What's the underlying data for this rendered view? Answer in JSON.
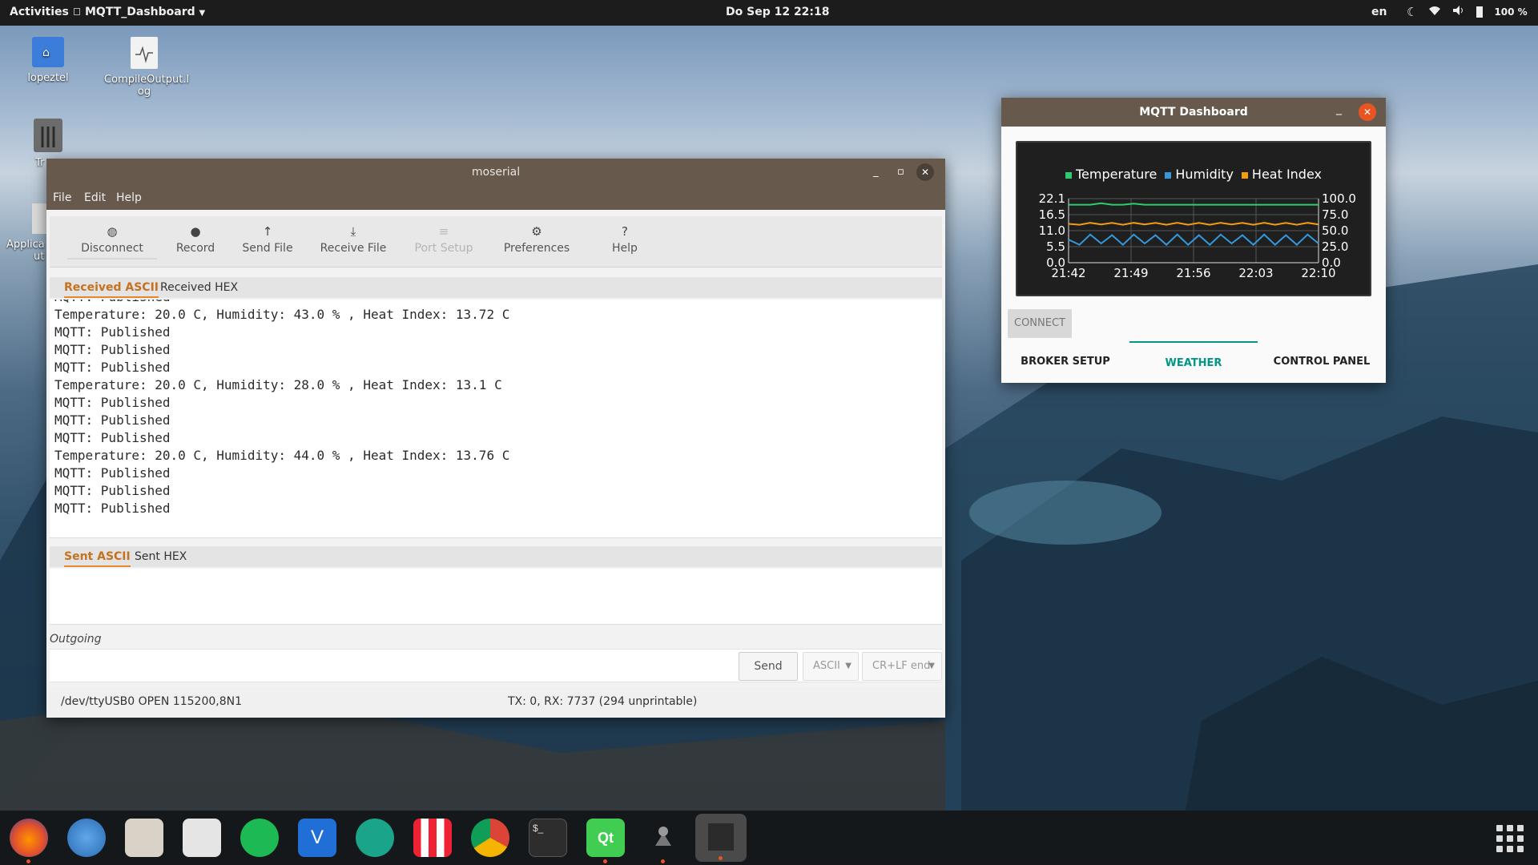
{
  "topbar": {
    "activities": "Activities",
    "app_menu": "MQTT_Dashboard",
    "clock": "Do Sep 12  22:18",
    "lang": "en",
    "battery": "100 %",
    "icons": [
      "night-light-icon",
      "wifi-icon",
      "volume-icon",
      "battery-icon"
    ]
  },
  "desktop": {
    "icons": [
      {
        "label": "lopeztel",
        "icon": "home-folder-icon"
      },
      {
        "label": "CompileOutput.log",
        "icon": "log-file-icon"
      },
      {
        "label": "Trash",
        "icon": "trash-icon"
      },
      {
        "label": "Applications",
        "icon": "app-icon"
      }
    ],
    "label_home": "lopeztel",
    "label_log_1": "CompileOutput.l",
    "label_log_2": "og",
    "label_trash": "Tr",
    "label_apps_1": "Applica",
    "label_apps_2": "ut"
  },
  "moserial": {
    "title": "moserial",
    "menu": {
      "file": "File",
      "edit": "Edit",
      "help": "Help"
    },
    "toolbar": {
      "disconnect": "Disconnect",
      "record": "Record",
      "send_file": "Send File",
      "receive_file": "Receive File",
      "port_setup": "Port Setup",
      "preferences": "Preferences",
      "help": "Help"
    },
    "recv_tabs": {
      "ascii": "Received ASCII",
      "hex": "Received HEX"
    },
    "received_lines": [
      "MQTT: Published",
      "Temperature: 20.0 C, Humidity: 43.0 % , Heat Index: 13.72 C",
      "MQTT: Published",
      "MQTT: Published",
      "MQTT: Published",
      "Temperature: 20.0 C, Humidity: 28.0 % , Heat Index: 13.1 C",
      "MQTT: Published",
      "MQTT: Published",
      "MQTT: Published",
      "Temperature: 20.0 C, Humidity: 44.0 % , Heat Index: 13.76 C",
      "MQTT: Published",
      "MQTT: Published",
      "MQTT: Published"
    ],
    "sent_tabs": {
      "ascii": "Sent ASCII",
      "hex": "Sent HEX"
    },
    "outgoing_label": "Outgoing",
    "outgoing_value": "",
    "send_label": "Send",
    "encoding": "ASCII",
    "line_end": "CR+LF end",
    "status_port": "/dev/ttyUSB0 OPEN 115200,8N1",
    "status_counts": "TX: 0, RX: 7737 (294 unprintable)"
  },
  "mqtt_dashboard": {
    "title": "MQTT Dashboard",
    "connect_label": "CONNECT",
    "tabs": {
      "broker": "BROKER SETUP",
      "weather": "WEATHER",
      "control": "CONTROL PANEL"
    },
    "active_tab": "WEATHER",
    "colors": {
      "temperature": "#2ecc71",
      "humidity": "#3498db",
      "heat_index": "#f39c12",
      "accent": "#009688"
    }
  },
  "chart_data": {
    "type": "line",
    "legend": [
      "Temperature",
      "Humidity",
      "Heat Index"
    ],
    "x_ticks": [
      "21:42",
      "21:49",
      "21:56",
      "22:03",
      "22:10"
    ],
    "y_left_ticks": [
      "22.1",
      "16.5",
      "11.0",
      "5.5",
      "0.0"
    ],
    "y_right_ticks": [
      "100.0",
      "75.0",
      "50.0",
      "25.0",
      "0.0"
    ],
    "ylim_left": [
      0,
      22.1
    ],
    "ylim_right": [
      0,
      100
    ],
    "grid": true,
    "series": [
      {
        "name": "Temperature",
        "axis": "left",
        "color": "#2ecc71",
        "values": [
          20.0,
          20.0,
          20.0,
          20.5,
          20.0,
          20.0,
          20.4,
          20.0,
          20.0,
          20.0,
          20.0,
          20.0,
          20.0,
          20.0,
          20.0,
          20.0,
          20.0,
          20.0,
          20.0,
          20.0,
          20.0,
          20.0,
          20.0,
          20.0
        ]
      },
      {
        "name": "Humidity",
        "axis": "right",
        "color": "#3498db",
        "values": [
          36,
          28,
          44,
          30,
          43,
          28,
          44,
          30,
          43,
          28,
          44,
          28,
          43,
          28,
          44,
          30,
          43,
          28,
          44,
          28,
          43,
          28,
          44,
          30
        ]
      },
      {
        "name": "Heat Index",
        "axis": "left",
        "color": "#f39c12",
        "values": [
          13.4,
          13.1,
          13.76,
          13.2,
          13.72,
          13.1,
          13.76,
          13.2,
          13.72,
          13.1,
          13.76,
          13.1,
          13.72,
          13.1,
          13.76,
          13.2,
          13.72,
          13.1,
          13.76,
          13.1,
          13.72,
          13.1,
          13.76,
          13.2
        ]
      }
    ]
  }
}
